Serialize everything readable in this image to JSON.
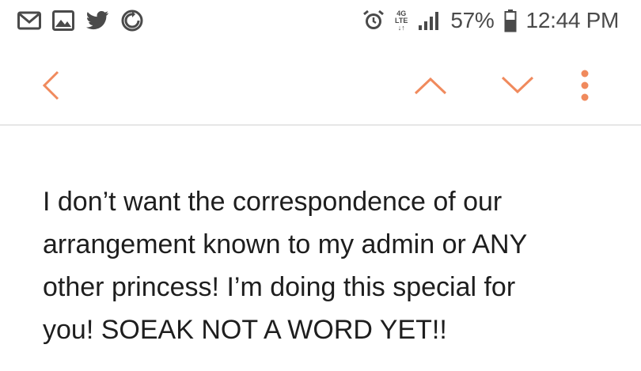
{
  "status_bar": {
    "icons": [
      "mail-icon",
      "gallery-icon",
      "twitter-icon",
      "sync-icon"
    ],
    "right_icons": [
      "alarm-icon",
      "network-4g-lte-icon",
      "signal-icon",
      "battery-icon"
    ],
    "network_label_top": "4G",
    "network_label_bottom": "LTE",
    "battery_percent": "57%",
    "time": "12:44 PM"
  },
  "toolbar": {
    "accent_color": "#F08A5D",
    "back_icon": "chevron-left-icon",
    "prev_icon": "chevron-up-icon",
    "next_icon": "chevron-down-icon",
    "more_icon": "more-vert-icon"
  },
  "message": {
    "lines": [
      "I don’t want the correspondence of our",
      "arrangement known to my admin or ANY",
      "other princess! I’m doing this special for",
      "you! SOEAK NOT A WORD YET!!"
    ]
  }
}
